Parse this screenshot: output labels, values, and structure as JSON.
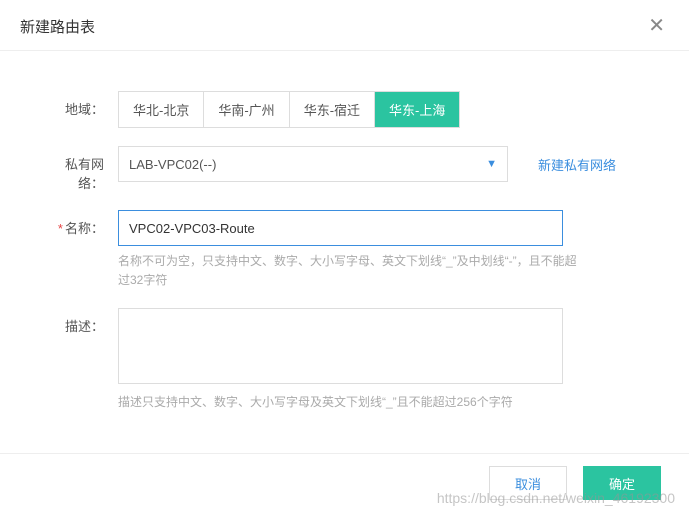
{
  "dialog": {
    "title": "新建路由表",
    "close_glyph": "✕"
  },
  "form": {
    "region": {
      "label": "地域：",
      "options": [
        "华北-北京",
        "华南-广州",
        "华东-宿迁",
        "华东-上海"
      ],
      "selected_index": 3
    },
    "vpc": {
      "label": "私有网络：",
      "value": "LAB-VPC02(--)",
      "create_link": "新建私有网络"
    },
    "name": {
      "label": "名称：",
      "required_mark": "*",
      "value": "VPC02-VPC03-Route",
      "help": "名称不可为空，只支持中文、数字、大小写字母、英文下划线“_”及中划线“-”，且不能超过32字符"
    },
    "desc": {
      "label": "描述：",
      "value": "",
      "help": "描述只支持中文、数字、大小写字母及英文下划线“_”且不能超过256个字符"
    }
  },
  "footer": {
    "cancel": "取消",
    "confirm": "确定"
  },
  "watermark": "https://blog.csdn.net/weixin_46192300"
}
